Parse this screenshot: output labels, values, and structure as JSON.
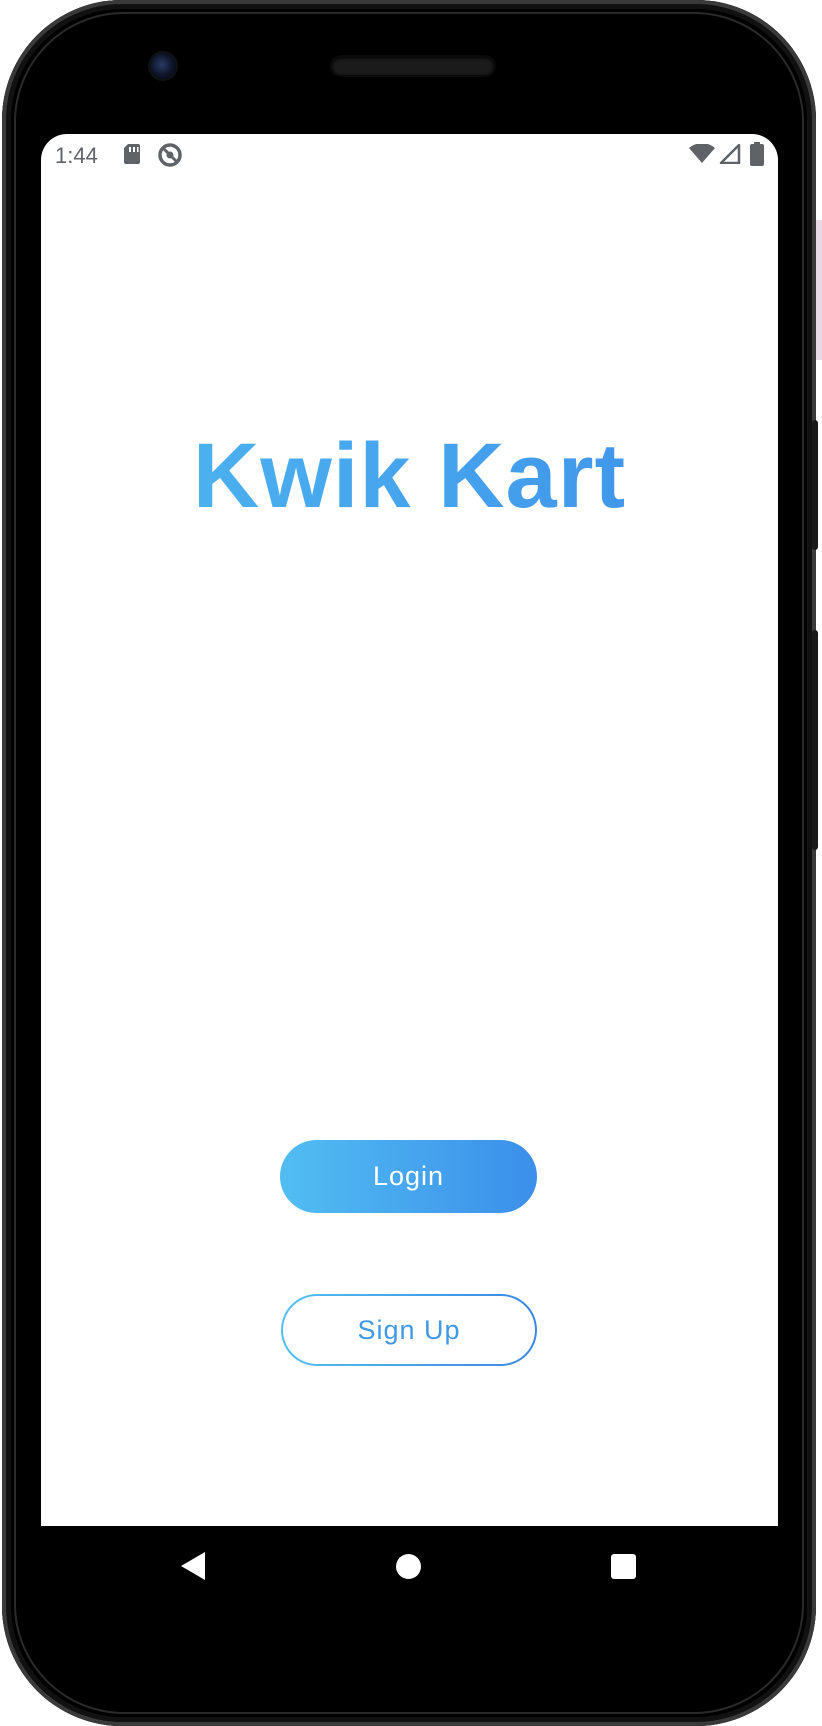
{
  "status_bar": {
    "time": "1:44",
    "left_icons": [
      "sd-card-icon",
      "data-saver-icon"
    ],
    "right_icons": [
      "wifi-icon",
      "cell-signal-icon",
      "battery-icon"
    ]
  },
  "app": {
    "title": "Kwik Kart",
    "login_label": "Login",
    "signup_label": "Sign Up"
  },
  "nav_bar": {
    "icons": [
      "back-icon",
      "home-icon",
      "recents-icon"
    ]
  },
  "colors": {
    "accent_start": "#4fb9f0",
    "accent_end": "#3b8fea",
    "status_text": "#5f6368",
    "screen_background": "#ffffff",
    "device_frame": "#000000"
  }
}
